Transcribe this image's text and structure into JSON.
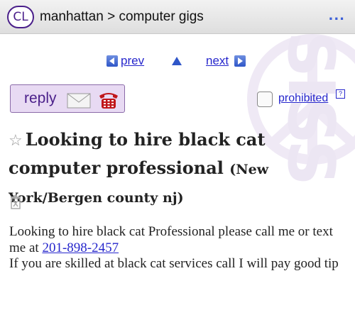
{
  "header": {
    "logo": "CL",
    "breadcrumb": "manhattan > computer gigs",
    "menu": "..."
  },
  "nav": {
    "prev_label": "prev",
    "next_label": "next"
  },
  "actions": {
    "reply_label": "reply",
    "prohibited_label": "prohibited",
    "help_label": "?"
  },
  "posting": {
    "title": "Looking to hire black cat computer professional",
    "location": "(New York/Bergen county nj)",
    "body_line1": "Looking to hire black cat Professional please call me or text me at ",
    "phone": "201-898-2457",
    "body_line2": "If you are skilled at black cat services call I will pay good tip"
  },
  "watermark": {
    "text": "SISS"
  },
  "colors": {
    "link": "#2626cc",
    "brand": "#4a1f8a",
    "reply_bg": "#e8daf3"
  },
  "icons": [
    "star-icon",
    "mail-icon",
    "phone-icon",
    "trash-icon",
    "prev-arrow-icon",
    "next-arrow-icon",
    "up-arrow-icon"
  ]
}
